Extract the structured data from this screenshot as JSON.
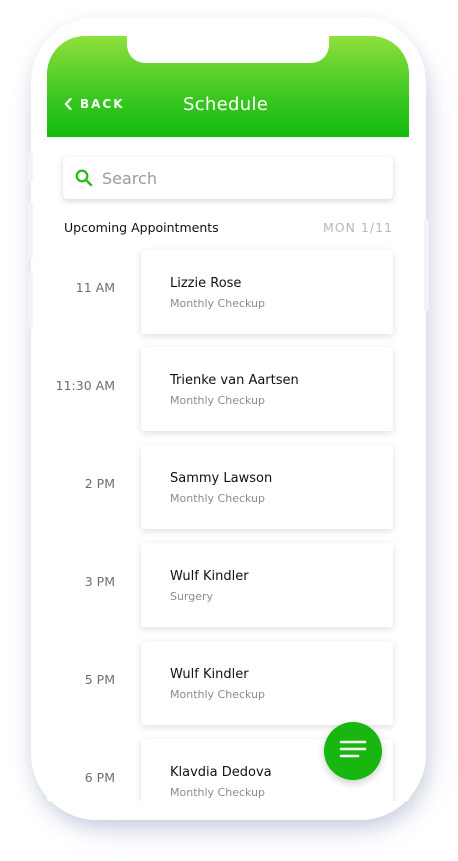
{
  "header": {
    "back_label": "BACK",
    "title": "Schedule"
  },
  "search": {
    "placeholder": "Search"
  },
  "section": {
    "title": "Upcoming Appointments",
    "date": "MON 1/11"
  },
  "appointments": [
    {
      "time": "11 AM",
      "name": "Lizzie Rose",
      "type": "Monthly Checkup"
    },
    {
      "time": "11:30 AM",
      "name": "Trienke van Aartsen",
      "type": "Monthly Checkup"
    },
    {
      "time": "2 PM",
      "name": "Sammy Lawson",
      "type": "Monthly Checkup"
    },
    {
      "time": "3 PM",
      "name": "Wulf Kindler",
      "type": "Surgery"
    },
    {
      "time": "5 PM",
      "name": "Wulf Kindler",
      "type": "Monthly Checkup"
    },
    {
      "time": "6 PM",
      "name": "Klavdia Dedova",
      "type": "Monthly Checkup"
    }
  ],
  "icons": {
    "back": "chevron-left-icon",
    "search": "search-icon",
    "menu": "menu-icon"
  },
  "colors": {
    "accent": "#17b70f",
    "header_top": "#8fe03c",
    "header_bottom": "#14bb0c"
  }
}
